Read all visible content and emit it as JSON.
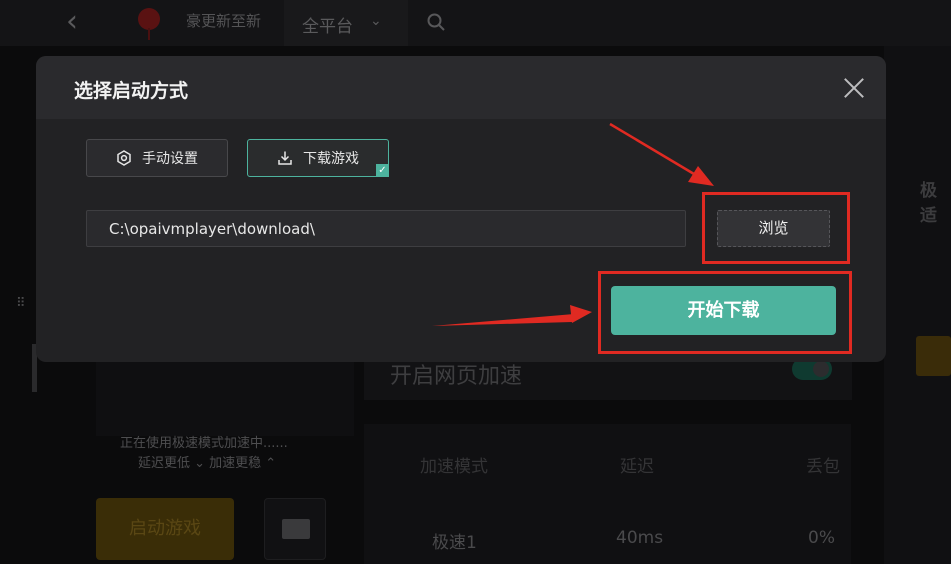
{
  "background": {
    "back_glyph": "‹",
    "news_text": "豪更新至新",
    "platform_filter": "全平台",
    "chevron_glyph": "⌄",
    "right_edge_label": "极适",
    "left_icon_glyph": "⠿",
    "status_line1": "正在使用极速模式加速中......",
    "status_line2": "延迟更低 ⌄ 加速更稳 ⌃",
    "launch_button": "启动游戏",
    "web_accel_label": "开启网页加速",
    "table": {
      "headers": [
        "加速模式",
        "延迟",
        "丢包"
      ],
      "row": [
        "极速1",
        "40ms",
        "0%"
      ]
    }
  },
  "dialog": {
    "title": "选择启动方式",
    "close_label": "",
    "options": [
      {
        "label": "手动设置",
        "icon": "gear-icon",
        "selected": false
      },
      {
        "label": "下载游戏",
        "icon": "download-icon",
        "selected": true
      }
    ],
    "check_glyph": "✓",
    "path_value": "C:\\opaivmplayer\\download\\",
    "browse_label": "浏览",
    "start_label": "开始下载"
  },
  "colors": {
    "accent": "#4db39e",
    "annotation_red": "#e02a22",
    "dialog_bg": "#222224"
  }
}
